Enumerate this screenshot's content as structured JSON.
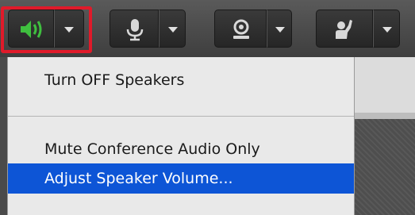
{
  "toolbar": {
    "buttons": [
      {
        "icon": "speaker-icon",
        "active": true
      },
      {
        "icon": "microphone-icon",
        "active": false
      },
      {
        "icon": "webcam-icon",
        "active": false
      },
      {
        "icon": "raise-hand-icon",
        "active": false
      }
    ]
  },
  "colors": {
    "highlight_border": "#e01a2a",
    "selected_item_bg": "#0d55d6",
    "speaker_active": "#3fbf3f"
  },
  "menu": {
    "items": [
      {
        "label": "Turn OFF Speakers",
        "selected": false
      },
      {
        "label": "Mute Conference Audio Only",
        "selected": false
      },
      {
        "label": "Adjust Speaker Volume...",
        "selected": true
      }
    ]
  }
}
